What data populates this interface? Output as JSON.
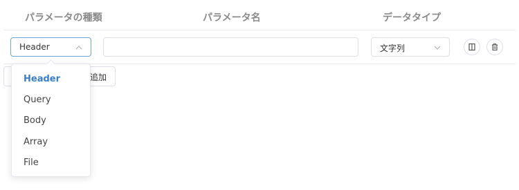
{
  "table": {
    "headers": [
      "パラメータの種類",
      "パラメータ名",
      "データタイプ"
    ]
  },
  "row": {
    "param_type": "Header",
    "param_name_value": "",
    "data_type": "文字列"
  },
  "icons": {
    "param_type_caret": "chevron-up-icon",
    "data_type_caret": "chevron-down-icon",
    "action_1": "bracket-icon",
    "action_2": "trash-icon"
  },
  "add_button_label": "追加",
  "dropdown": {
    "options": [
      "Header",
      "Query",
      "Body",
      "Array",
      "File"
    ],
    "selected": "Header"
  },
  "colors": {
    "accent": "#3a7fc9",
    "focus_border": "#6ea5d8",
    "header_text": "#8a8a8a"
  }
}
